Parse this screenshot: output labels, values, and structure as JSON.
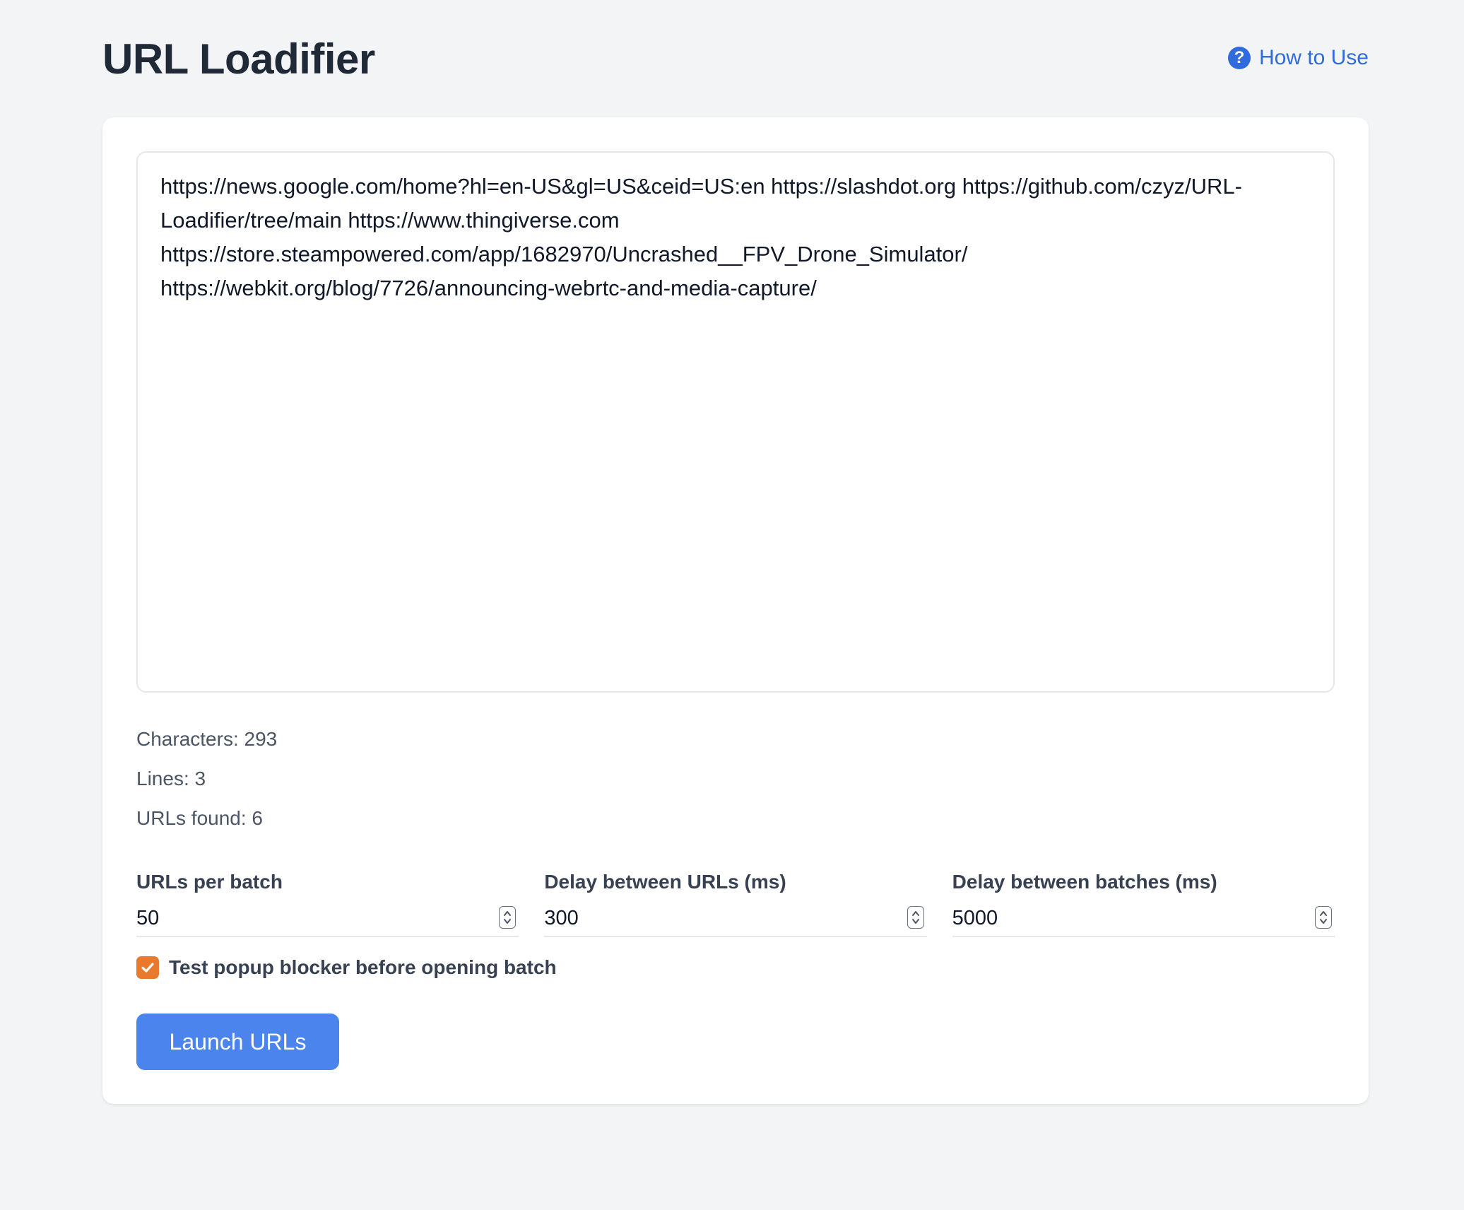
{
  "app": {
    "title": "URL Loadifier"
  },
  "help": {
    "icon": "question-circle-icon",
    "label": "How to Use",
    "color": "#2f6bdc"
  },
  "editor": {
    "value": "https://news.google.com/home?hl=en-US&gl=US&ceid=US:en https://slashdot.org https://github.com/czyz/URL-Loadifier/tree/main https://www.thingiverse.com\nhttps://store.steampowered.com/app/1682970/Uncrashed__FPV_Drone_Simulator/\nhttps://webkit.org/blog/7726/announcing-webrtc-and-media-capture/"
  },
  "stats": {
    "characters": "Characters: 293",
    "lines": "Lines: 3",
    "urls_found": "URLs found: 6"
  },
  "settings": {
    "urls_per_batch": {
      "label": "URLs per batch",
      "value": "50"
    },
    "delay_between_urls": {
      "label": "Delay between URLs (ms)",
      "value": "300"
    },
    "delay_between_batches": {
      "label": "Delay between batches (ms)",
      "value": "5000"
    }
  },
  "popup_test": {
    "label": "Test popup blocker before opening batch",
    "checked": true,
    "accent_color": "#e8792d"
  },
  "launch": {
    "label": "Launch URLs",
    "color": "#4a84ec"
  }
}
